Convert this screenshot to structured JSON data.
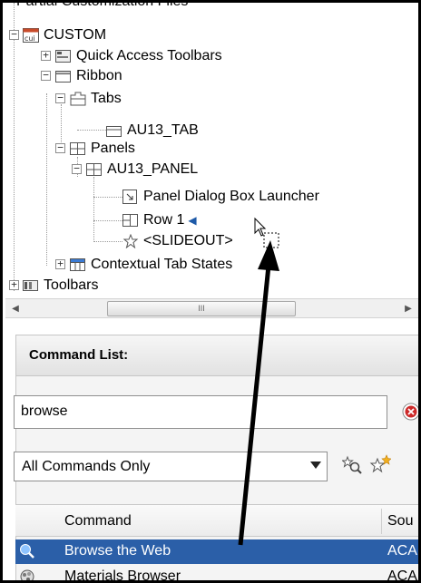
{
  "tree": {
    "top_partial_label": "Partial Customization Files",
    "custom": "CUSTOM",
    "quick_access": "Quick Access Toolbars",
    "ribbon": "Ribbon",
    "tabs": "Tabs",
    "au13_tab": "AU13_TAB",
    "panels": "Panels",
    "au13_panel": "AU13_PANEL",
    "dialog_launcher": "Panel Dialog Box Launcher",
    "row1": "Row 1",
    "slideout": "<SLIDEOUT>",
    "contextual": "Contextual Tab States",
    "toolbars": "Toolbars"
  },
  "scrollbar": {
    "thumb_grip": "III"
  },
  "command_list": {
    "header": "Command List:",
    "search_value": "browse",
    "filter_value": "All Commands Only",
    "columns": [
      "Command",
      "Sou"
    ],
    "rows": [
      {
        "name": "Browse the Web",
        "source": "ACA",
        "selected": true,
        "icon": "globe-search-icon"
      },
      {
        "name": "Materials Browser",
        "source": "ACA",
        "selected": false,
        "icon": "materials-icon"
      }
    ]
  },
  "colors": {
    "selection": "#2b5fa8",
    "accent_arrow": "#1e5aa8",
    "clear_red": "#cc2a2a"
  }
}
